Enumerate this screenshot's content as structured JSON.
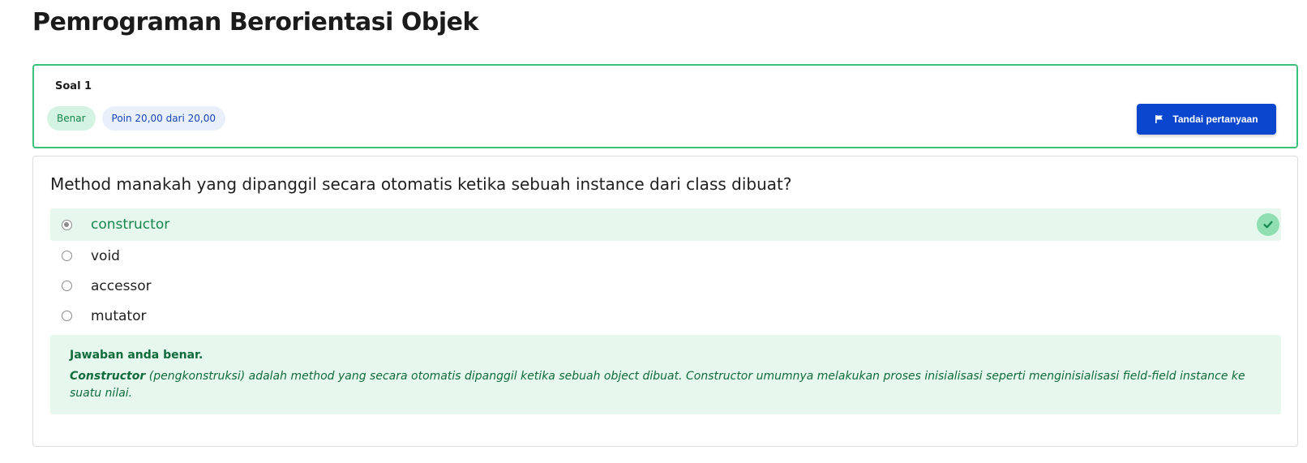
{
  "page": {
    "title": "Pemrograman Berorientasi Objek"
  },
  "question": {
    "label": "Soal 1",
    "status_badge": "Benar",
    "points_badge": "Poin 20,00 dari 20,00",
    "flag_button_label": "Tandai pertanyaan",
    "text": "Method manakah yang dipanggil secara otomatis ketika sebuah instance dari class dibuat?",
    "options": [
      {
        "label": "constructor",
        "selected": true,
        "correct": true
      },
      {
        "label": "void",
        "selected": false
      },
      {
        "label": "accessor",
        "selected": false
      },
      {
        "label": "mutator",
        "selected": false
      }
    ]
  },
  "feedback": {
    "title": "Jawaban anda benar.",
    "term": "Constructor",
    "body": " (pengkonstruksi) adalah method yang secara otomatis dipanggil ketika sebuah object dibuat. Constructor umumnya melakukan proses inisialisasi seperti menginisialisasi field-field instance ke suatu nilai."
  },
  "colors": {
    "success_border": "#3cc17a",
    "success_bg": "#e6f7ee",
    "success_text": "#15874d",
    "primary": "#0b46cf",
    "badge_points_bg": "#eaf0fb"
  },
  "icons": {
    "flag": "flag-icon",
    "check": "check-icon"
  }
}
